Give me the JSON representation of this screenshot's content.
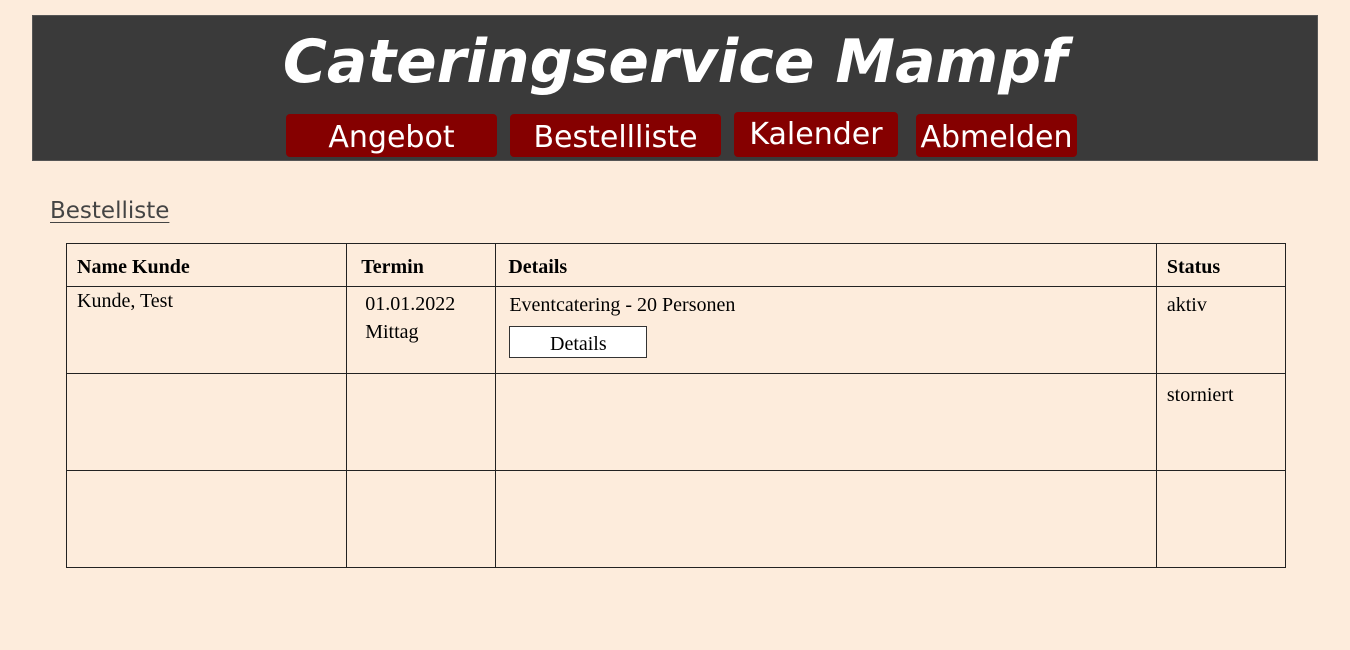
{
  "header": {
    "title": "Cateringservice Mampf",
    "nav": {
      "angebot": "Angebot",
      "bestellliste": "Bestellliste",
      "kalender": "Kalender",
      "abmelden": "Abmelden"
    },
    "background": "#3a3a3a",
    "button_color": "#850000"
  },
  "page": {
    "section_title": "Bestelliste",
    "background": "#fdecdc"
  },
  "table": {
    "columns": [
      "Name Kunde",
      "Termin",
      "Details",
      "Status"
    ],
    "rows": [
      {
        "name": "Kunde, Test",
        "termin_date": "01.01.2022",
        "termin_time": "Mittag",
        "details": "Eventcatering - 20 Personen",
        "details_button": "Details",
        "status": "aktiv"
      },
      {
        "name": "",
        "termin_date": "",
        "termin_time": "",
        "details": "",
        "status": "storniert"
      },
      {
        "name": "",
        "termin_date": "",
        "termin_time": "",
        "details": "",
        "status": ""
      }
    ]
  }
}
